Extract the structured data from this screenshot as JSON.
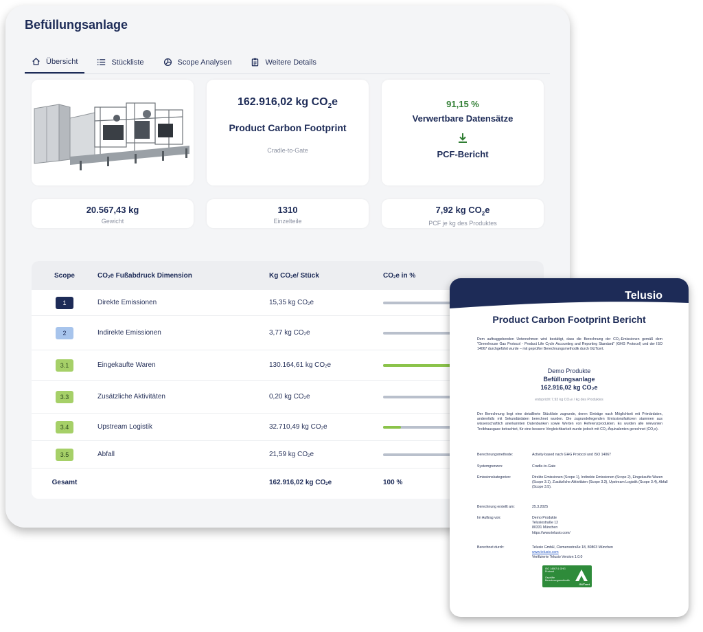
{
  "dashboard": {
    "title": "Befüllungsanlage",
    "tabs": [
      {
        "label": "Übersicht",
        "icon": "home-icon",
        "active": true
      },
      {
        "label": "Stückliste",
        "icon": "list-icon",
        "active": false
      },
      {
        "label": "Scope Analysen",
        "icon": "pie-chart-icon",
        "active": false
      },
      {
        "label": "Weitere Details",
        "icon": "clipboard-icon",
        "active": false
      }
    ],
    "pcf_card": {
      "value": "162.916,02 kg CO",
      "sub": "2",
      "unit_suffix": "e",
      "title": "Product Carbon Footprint",
      "boundary": "Cradle-to-Gate"
    },
    "data_card": {
      "percent": "91,15 %",
      "label": "Verwertbare Datensätze",
      "report_label": "PCF-Bericht"
    },
    "kpis": [
      {
        "value": "20.567,43 kg",
        "label": "Gewicht"
      },
      {
        "value": "1310",
        "label": "Einzelteile"
      },
      {
        "value": "7,92 kg CO",
        "value_sub": "2",
        "value_suffix": "e",
        "label": "PCF je kg des Produktes"
      }
    ],
    "table": {
      "headers": {
        "scope": "Scope",
        "dim_prefix": "CO",
        "dim_sub": "2",
        "dim_suffix": "e Fußabdruck Dimension",
        "kg_prefix": "Kg CO",
        "kg_sub": "2",
        "kg_suffix": "e/ Stück",
        "pct_prefix": "CO",
        "pct_sub": "2",
        "pct_suffix": "e in %"
      },
      "rows": [
        {
          "scope": "1",
          "dimension": "Direkte Emissionen",
          "kg": "15,35 kg CO",
          "kg_sub": "2",
          "kg_suffix": "e",
          "share": 0.0001
        },
        {
          "scope": "2",
          "dimension": "Indirekte Emissionen",
          "kg": "3,77 kg CO",
          "kg_sub": "2",
          "kg_suffix": "e",
          "share": 2e-05
        },
        {
          "scope": "3.1",
          "dimension": "Eingekaufte Waren",
          "kg": "130.164,61 kg CO",
          "kg_sub": "2",
          "kg_suffix": "e",
          "share": 0.799
        },
        {
          "scope": "3.3",
          "dimension": "Zusätzliche Aktivitäten",
          "kg": "0,20 kg CO",
          "kg_sub": "2",
          "kg_suffix": "e",
          "share": 1e-06
        },
        {
          "scope": "3.4",
          "dimension": "Upstream Logistik",
          "kg": "32.710,49 kg CO",
          "kg_sub": "2",
          "kg_suffix": "e",
          "share": 0.201
        },
        {
          "scope": "3.5",
          "dimension": "Abfall",
          "kg": "21,59 kg CO",
          "kg_sub": "2",
          "kg_suffix": "e",
          "share": 0.0001
        }
      ],
      "total": {
        "label": "Gesamt",
        "kg": "162.916,02 kg CO",
        "kg_sub": "2",
        "kg_suffix": "e",
        "pct": "100 %"
      }
    }
  },
  "report": {
    "logo": "Telusio",
    "title": "Product Carbon Footprint Bericht",
    "intro": "Dem auftraggebenden Unternehmen wird bestätigt, dass die Berechnung der CO₂-Emissionen gemäß dem \"Greenhouse Gas Protocol - Product Life Cycle Accounting and Reporting Standard\" (GHG Protocol) und der ISO 14067 durchgeführt wurde – mit geprüfter Berechnungsmethodik durch GUTcert.",
    "company": "Demo Produkte",
    "product": "Befüllungsanlage",
    "total": "162.916,02 kg CO₂e",
    "per_kg": "entspricht 7,92  kg CO₂e / kg des Produktes",
    "body": "Der Berechnung liegt eine detaillierte Stückliste zugrunde, deren Einträge nach Möglichkeit mit Primärdaten, andernfalls mit Sekundärdaten berechnet wurden. Die zugrundeliegenden Emissionsfaktoren stammen aus wissenschaftlich anerkannten Datenbanken sowie Werten von Referenzprodukten. Es wurden alle relevanten Treibhausgase betrachtet, für eine bessere Vergleichbarkeit wurde jedoch mit CO₂-Äquivalenten gerechnet (CO₂e).",
    "fields": [
      {
        "k": "Berechnungsmethode:",
        "v": "Activity-based nach GHG Protocol und ISO 14067"
      },
      {
        "k": "Systemgrenzen:",
        "v": "Cradle-to-Gate"
      },
      {
        "k": "Emissionskategorien:",
        "v": "Direkte Emissionen (Scope 1), Indirekte Emissionen (Scope 2), Eingekaufte Waren (Scope 3.1), Zusätzliche Aktivitäten (Scope 3.3), Upstream Logistik (Scope 3.4), Abfall (Scope 3.5)."
      },
      {
        "k": "Berechnung erstellt am:",
        "v": "25.3.2025"
      },
      {
        "k": "Im Auftrag von:",
        "v": "Demo Produkte"
      },
      {
        "k": "Berechnet durch:",
        "v": "Telusio GmbH, Clemensstraße 18, 80803 München"
      }
    ],
    "address": [
      "Telusiostraße 12",
      "80331 München",
      "https://www.telusio.com/"
    ],
    "link": "www.telusio.com",
    "version": "Verifizierte Telusio Version 1.0.0",
    "cert_text": "ISO 14067 & GHG Protocol",
    "cert_sub": "Geprüfte Berechnungsmethodik",
    "cert_brand": "GUTcert"
  },
  "colors": {
    "primary": "#1d2b57",
    "green": "#2f7d32",
    "bar_green": "#8bc34a",
    "bar_grey": "#b9c0cc"
  }
}
